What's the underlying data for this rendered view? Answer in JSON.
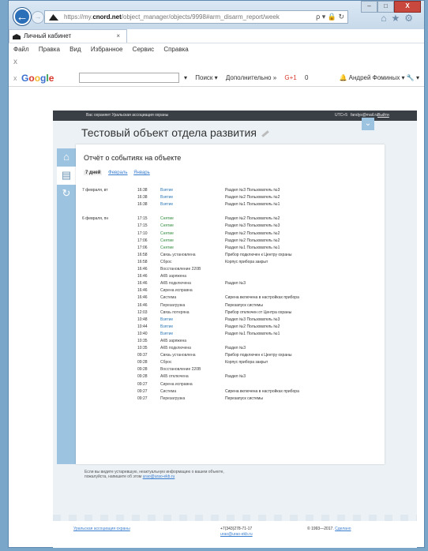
{
  "browser": {
    "address_prefix": "https://my.",
    "address_host": "cnord.net",
    "address_path": "/object_manager/objects/9998#arm_disarm_report/week",
    "address_tools": "ρ ▾ 🔒 ↻",
    "tab_title": "Личный кабинет",
    "tab_close": "×",
    "minimize": "–",
    "maximize": "□",
    "close": "X",
    "toolbar_icons": "⌂★⚙",
    "back_glyph": "←",
    "forward_glyph": "→",
    "addon_close": "x",
    "menu": [
      "Файл",
      "Правка",
      "Вид",
      "Избранное",
      "Сервис",
      "Справка"
    ]
  },
  "googlebar": {
    "close": "x",
    "logo": "Google",
    "search_arrow": "▾",
    "items": [
      "Поиск ▾",
      "Дополнительно »",
      "G+1",
      "0"
    ],
    "bell": "🔔",
    "user": "Андрей Фоминых ▾",
    "tools": "🔧 ▾"
  },
  "site": {
    "protect_text": "Вас охраняет Уральская ассоциация охраны",
    "utc": "UTC+5",
    "email": "fandys@mail.ru",
    "logout": "Выйти"
  },
  "page": {
    "title": "Тестовый объект отдела развития",
    "report_title": "Отчёт о событиях на объекте",
    "tabs": [
      "7 дней",
      "Февраль",
      "Январь"
    ]
  },
  "sidebar_icons": [
    "⌂",
    "▤",
    "↻"
  ],
  "chevron": "⌄",
  "rows": [
    {
      "date": "7 февраля, вт",
      "time": "16:38",
      "event": "Взятие",
      "ev_class": "blue",
      "detail": "Раздел №3 Пользователь №3"
    },
    {
      "date": "",
      "time": "16:38",
      "event": "Взятие",
      "ev_class": "blue",
      "detail": "Раздел №2 Пользователь №2"
    },
    {
      "date": "",
      "time": "16:38",
      "event": "Взятие",
      "ev_class": "blue",
      "detail": "Раздел №1 Пользователь №1"
    },
    {
      "date": "",
      "time": "",
      "event": "",
      "ev_class": "dark",
      "detail": ""
    },
    {
      "date": "6 февраля, пн",
      "time": "17:15",
      "event": "Снятие",
      "ev_class": "green",
      "detail": "Раздел №2 Пользователь №2"
    },
    {
      "date": "",
      "time": "17:15",
      "event": "Снятие",
      "ev_class": "green",
      "detail": "Раздел №3 Пользователь №3"
    },
    {
      "date": "",
      "time": "17:10",
      "event": "Снятие",
      "ev_class": "green",
      "detail": "Раздел №2 Пользователь №2"
    },
    {
      "date": "",
      "time": "17:06",
      "event": "Снятие",
      "ev_class": "green",
      "detail": "Раздел №2 Пользователь №2"
    },
    {
      "date": "",
      "time": "17:06",
      "event": "Снятие",
      "ev_class": "green",
      "detail": "Раздел №1 Пользователь №1"
    },
    {
      "date": "",
      "time": "16:58",
      "event": "Связь установлена",
      "ev_class": "dark",
      "detail": "Прибор подключен к Центру охраны"
    },
    {
      "date": "",
      "time": "16:58",
      "event": "Сброс",
      "ev_class": "dark",
      "detail": "Корпус прибора закрыт"
    },
    {
      "date": "",
      "time": "16:46",
      "event": "Восстановление 220В",
      "ev_class": "dark",
      "detail": ""
    },
    {
      "date": "",
      "time": "16:46",
      "event": "АКБ заряжена",
      "ev_class": "dark",
      "detail": ""
    },
    {
      "date": "",
      "time": "16:46",
      "event": "АКБ подключена",
      "ev_class": "dark",
      "detail": "Раздел №3"
    },
    {
      "date": "",
      "time": "16:46",
      "event": "Сирена исправна",
      "ev_class": "dark",
      "detail": ""
    },
    {
      "date": "",
      "time": "16:46",
      "event": "Система",
      "ev_class": "dark",
      "detail": "Сирена включена в настройках прибора"
    },
    {
      "date": "",
      "time": "16:46",
      "event": "Перезагрузка",
      "ev_class": "dark",
      "detail": "Перезапуск системы"
    },
    {
      "date": "",
      "time": "12:03",
      "event": "Связь потеряна",
      "ev_class": "dark",
      "detail": "Прибор отключен от Центра охраны"
    },
    {
      "date": "",
      "time": "10:48",
      "event": "Взятие",
      "ev_class": "blue",
      "detail": "Раздел №3 Пользователь №3"
    },
    {
      "date": "",
      "time": "10:44",
      "event": "Взятие",
      "ev_class": "blue",
      "detail": "Раздел №2 Пользователь №2"
    },
    {
      "date": "",
      "time": "10:40",
      "event": "Взятие",
      "ev_class": "blue",
      "detail": "Раздел №1 Пользователь №1"
    },
    {
      "date": "",
      "time": "10:35",
      "event": "АКБ заряжена",
      "ev_class": "dark",
      "detail": ""
    },
    {
      "date": "",
      "time": "10:35",
      "event": "АКБ подключена",
      "ev_class": "dark",
      "detail": "Раздел №3"
    },
    {
      "date": "",
      "time": "09:37",
      "event": "Связь установлена",
      "ev_class": "dark",
      "detail": "Прибор подключен к Центру охраны"
    },
    {
      "date": "",
      "time": "09:28",
      "event": "Сброс",
      "ev_class": "dark",
      "detail": "Корпус прибора закрыт"
    },
    {
      "date": "",
      "time": "09:28",
      "event": "Восстановление 220В",
      "ev_class": "dark",
      "detail": ""
    },
    {
      "date": "",
      "time": "09:28",
      "event": "АКБ отключена",
      "ev_class": "dark",
      "detail": "Раздел №3"
    },
    {
      "date": "",
      "time": "09:27",
      "event": "Сирена исправна",
      "ev_class": "dark",
      "detail": ""
    },
    {
      "date": "",
      "time": "09:27",
      "event": "Система",
      "ev_class": "dark",
      "detail": "Сирена включена в настройках прибора"
    },
    {
      "date": "",
      "time": "09:27",
      "event": "Перезагрузка",
      "ev_class": "dark",
      "detail": "Перезапуск системы"
    }
  ],
  "note": {
    "line1": "Если вы видите устаревшую, неактуальную информацию о вашем объекте,",
    "line2_prefix": "пожалуйста, напишите об этом ",
    "email": "urao@urao-ekb.ru"
  },
  "footer": {
    "org": "Уральская ассоциация охраны",
    "phone": "+7(343)278-71-17",
    "email": "urao@urao-ekb.ru",
    "copyright": "© 1993—2017.",
    "made_by": "Сделано"
  }
}
